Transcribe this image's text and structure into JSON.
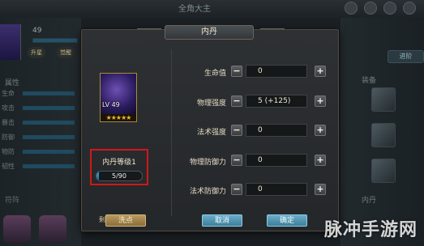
{
  "background": {
    "title": "全角大主",
    "hero_level": "49",
    "btn_upgrade": "升星",
    "btn_awaken": "觉醒",
    "attr_title": "属性",
    "attr_labels": [
      "生命",
      "攻击",
      "暴击",
      "防御",
      "物防",
      "韧性"
    ],
    "bottom_left": "符阵",
    "right_btn": "进阶",
    "right_label_equip": "装备",
    "right_label_core": "内丹"
  },
  "dialog": {
    "title": "内丹",
    "portrait_level": "LV 49",
    "stars": "★★★★★",
    "core_level": "内丹等级1",
    "progress_text": "5/90",
    "progress_fraction": 0.056,
    "remaining_points": "剩余属性点：0",
    "attributes": [
      {
        "label": "生命值",
        "value": "0"
      },
      {
        "label": "物理强度",
        "value": "5 (+125)"
      },
      {
        "label": "法术强度",
        "value": "0"
      },
      {
        "label": "物理防御力",
        "value": "0"
      },
      {
        "label": "法术防御力",
        "value": "0"
      }
    ],
    "minus_symbol": "−",
    "plus_symbol": "+",
    "btn_wash": "洗点",
    "btn_cancel": "取消",
    "btn_confirm": "确定"
  },
  "watermark": "脉冲手游网",
  "colors": {
    "highlight_box": "#d01818",
    "progress": "#3ea7d8",
    "primary_button": "#5aa4c2",
    "wash_button": "#a88a52"
  }
}
